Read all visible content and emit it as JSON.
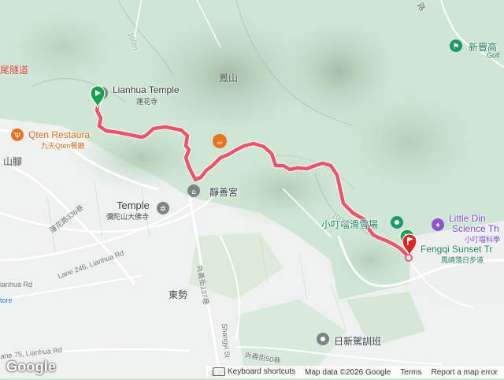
{
  "map": {
    "labels": {
      "tunnel": "尾隧道",
      "lianhua_temple": "Lianhua Temple",
      "lianhua_temple_zh": "蓮花寺",
      "fengshan": "鳳山",
      "qten_restaurant": "Qten Restaura",
      "qten_restaurant_zh": "九天Qten餐廳",
      "shanjiao": "山腳",
      "temple": "Temple",
      "temple_zh": "彌陀山大佛寺",
      "jingshan_palace": "靜善宮",
      "xiaodingdang_park": "小叮噹滑雪場",
      "little_dino": "Little Din",
      "little_dino_line2": "Science Th",
      "xiaodingdang_science_zh": "小叮噹科學",
      "fengqi_trail": "Fengqi Sunset Tr",
      "fengqi_trail_zh": "鳳崎落日步道",
      "xinfeng_golf": "新豐高",
      "golf": "Golf",
      "dongshi": "東勢",
      "dongshi_bottom": "東勢",
      "rixin_school": "日新駕訓班",
      "road_lianhua336": "蓮花路336巷",
      "road_lane246": "Lane 246, Lianhua Rd",
      "road_lianhua": "ianhua Rd",
      "road_lane75": "ane 75, Lianhua Rd",
      "road_shangyi137": "尚義街137巷",
      "road_shangyi_st": "Shangyi St",
      "road_shangyi50": "尚義街50巷",
      "road_corner": "路",
      "store": "tore",
      "contour_100m_a": "100m",
      "contour_100m_b": "100m"
    },
    "colors": {
      "route": "#e9546b",
      "marker_start": "#16a34a",
      "marker_end": "#dc2626",
      "poi_orange": "#e8711a",
      "poi_gray": "#7b8487",
      "poi_purple": "#8e50d8",
      "poi_teal": "#1d9a6c"
    }
  },
  "footer": {
    "logo": "Google",
    "keyboard": "Keyboard shortcuts",
    "map_data": "Map data ©2026 Google",
    "terms": "Terms",
    "report": "Report a map error"
  }
}
